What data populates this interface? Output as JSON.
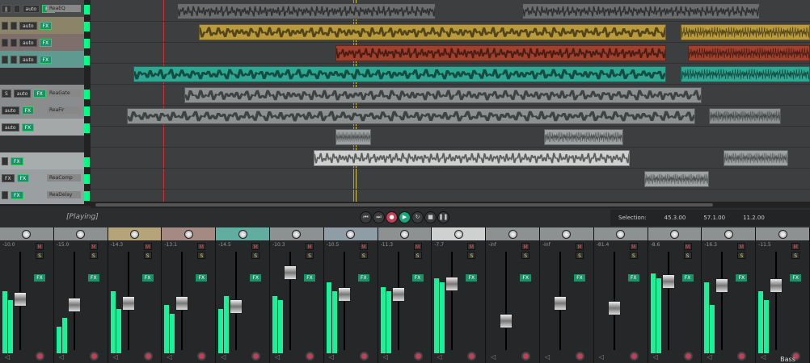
{
  "tracks": [
    {
      "color": "#4a4b4d",
      "btns": [
        "ǀǀ",
        "",
        "auto"
      ],
      "plug": "ReaEQ"
    },
    {
      "color": "#8b8468",
      "btns": [
        "",
        "",
        "auto"
      ],
      "plug": ""
    },
    {
      "color": "#7e6e6c",
      "btns": [
        "",
        "",
        "auto"
      ],
      "plug": ""
    },
    {
      "color": "#5f9a90",
      "btns": [
        "",
        "",
        "auto"
      ],
      "plug": ""
    },
    {
      "color": "#333436",
      "btns": [],
      "plug": ""
    },
    {
      "color": "#8a8c8e",
      "btns": [
        "S",
        "auto"
      ],
      "plug": "ReaGate"
    },
    {
      "color": "#8a8c8e",
      "btns": [
        "auto"
      ],
      "plug": "ReaFir"
    },
    {
      "color": "#a4a8a8",
      "btns": [
        "auto"
      ],
      "plug": ""
    },
    {
      "color": "#333436",
      "btns": [],
      "plug": ""
    },
    {
      "color": "#a7acad",
      "btns": [
        ""
      ],
      "plug": ""
    },
    {
      "color": "#9aa0a1",
      "btns": [
        "FX"
      ],
      "plug": "ReaComp"
    },
    {
      "color": "#9aa0a1",
      "btns": [
        ""
      ],
      "plug": "ReaDelay"
    }
  ],
  "fx_label": "FX",
  "clips": [
    {
      "lane": 0,
      "start": 0.12,
      "end": 0.48,
      "color": "#6a6c6e"
    },
    {
      "lane": 0,
      "start": 0.6,
      "end": 0.93,
      "color": "#6a6c6e"
    },
    {
      "lane": 1,
      "start": 0.15,
      "end": 0.8,
      "color": "#b99a3c"
    },
    {
      "lane": 1,
      "start": 0.82,
      "end": 1.0,
      "color": "#b99a3c"
    },
    {
      "lane": 2,
      "start": 0.34,
      "end": 0.8,
      "color": "#a1402c"
    },
    {
      "lane": 2,
      "start": 0.83,
      "end": 1.0,
      "color": "#a1402c"
    },
    {
      "lane": 3,
      "start": 0.06,
      "end": 0.8,
      "color": "#2fa893"
    },
    {
      "lane": 3,
      "start": 0.82,
      "end": 1.0,
      "color": "#2fa893"
    },
    {
      "lane": 4,
      "start": 0.13,
      "end": 0.85,
      "color": "#8d9192"
    },
    {
      "lane": 5,
      "start": 0.05,
      "end": 0.84,
      "color": "#8d9192"
    },
    {
      "lane": 5,
      "start": 0.86,
      "end": 0.96,
      "color": "#8d9192"
    },
    {
      "lane": 6,
      "start": 0.34,
      "end": 0.39,
      "color": "#9ea2a3"
    },
    {
      "lane": 6,
      "start": 0.63,
      "end": 0.74,
      "color": "#9ea2a3"
    },
    {
      "lane": 7,
      "start": 0.31,
      "end": 0.75,
      "color": "#cfd1d1"
    },
    {
      "lane": 7,
      "start": 0.88,
      "end": 0.97,
      "color": "#9ea2a3"
    },
    {
      "lane": 8,
      "start": 0.77,
      "end": 0.86,
      "color": "#9ea2a3"
    }
  ],
  "status": "[Playing]",
  "transport": [
    {
      "icon": "go-start-icon",
      "glyph": "⏮"
    },
    {
      "icon": "go-end-icon",
      "glyph": "⏭"
    },
    {
      "icon": "record-icon",
      "glyph": "●",
      "color": "#c0405a"
    },
    {
      "icon": "play-icon",
      "glyph": "▶",
      "color": "#1aa57a"
    },
    {
      "icon": "repeat-icon",
      "glyph": "↻"
    },
    {
      "icon": "stop-icon",
      "glyph": "■"
    },
    {
      "icon": "pause-icon",
      "glyph": "❚❚"
    }
  ],
  "selection": {
    "label": "Selection:",
    "start": "45.3.00",
    "end": "57.1.00",
    "length": "11.2.00"
  },
  "mixer": [
    {
      "vol": "-10.0",
      "color": "#8d9192",
      "fader": 0.55,
      "meter": [
        0.7,
        0.6
      ]
    },
    {
      "vol": "-15.0",
      "color": "#8d9192",
      "fader": 0.48,
      "meter": [
        0.3,
        0.4
      ]
    },
    {
      "vol": "-14.3",
      "color": "#b5a47a",
      "fader": 0.5,
      "meter": [
        0.7,
        0.5
      ]
    },
    {
      "vol": "-13.1",
      "color": "#a58983",
      "fader": 0.5,
      "meter": [
        0.55,
        0.45
      ]
    },
    {
      "vol": "-14.5",
      "color": "#5fae9f",
      "fader": 0.46,
      "meter": [
        0.5,
        0.65
      ]
    },
    {
      "vol": "-10.3",
      "color": "#8d9192",
      "fader": 0.85,
      "meter": [
        0.65,
        0.6
      ]
    },
    {
      "vol": "-10.5",
      "color": "#8f9ea6",
      "fader": 0.6,
      "meter": [
        0.8,
        0.7
      ]
    },
    {
      "vol": "-11.3",
      "color": "#8d9192",
      "fader": 0.6,
      "meter": [
        0.75,
        0.7
      ]
    },
    {
      "vol": "-7.7",
      "color": "#cfd1d1",
      "fader": 0.72,
      "meter": [
        0.85,
        0.8
      ]
    },
    {
      "vol": "-inf",
      "color": "#8d9192",
      "fader": 0.3,
      "meter": [
        0,
        0
      ]
    },
    {
      "vol": "-inf",
      "color": "#8d9192",
      "fader": 0.5,
      "meter": [
        0,
        0
      ]
    },
    {
      "vol": "-81.4",
      "color": "#8d9192",
      "fader": 0.45,
      "meter": [
        0,
        0
      ]
    },
    {
      "vol": "-8.6",
      "color": "#8d9192",
      "fader": 0.75,
      "meter": [
        0.9,
        0.85
      ]
    },
    {
      "vol": "-16.3",
      "color": "#8d9192",
      "fader": 0.7,
      "meter": [
        0.8,
        0.55
      ]
    },
    {
      "vol": "-11.5",
      "color": "#8d9192",
      "fader": 0.7,
      "meter": [
        0.7,
        0.6
      ],
      "name": "Bass"
    }
  ],
  "mute_label": "M",
  "solo_label": "S"
}
